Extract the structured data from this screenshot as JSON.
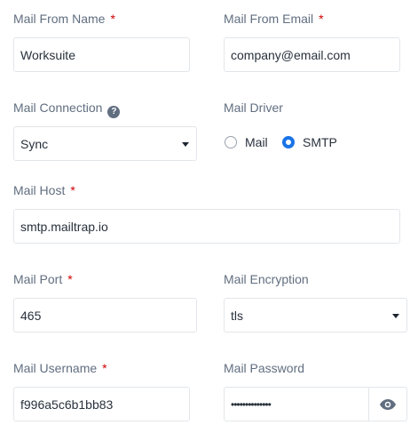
{
  "fields": {
    "mail_from_name": {
      "label": "Mail From Name",
      "required": "*",
      "value": "Worksuite"
    },
    "mail_from_email": {
      "label": "Mail From Email",
      "required": "*",
      "value": "company@email.com"
    },
    "mail_connection": {
      "label": "Mail Connection",
      "help_icon": "question-circle-icon",
      "value": "Sync"
    },
    "mail_driver": {
      "label": "Mail Driver",
      "options": [
        "Mail",
        "SMTP"
      ],
      "selected": "SMTP"
    },
    "mail_host": {
      "label": "Mail Host",
      "required": "*",
      "value": "smtp.mailtrap.io"
    },
    "mail_port": {
      "label": "Mail Port",
      "required": "*",
      "value": "465"
    },
    "mail_encryption": {
      "label": "Mail Encryption",
      "value": "tls"
    },
    "mail_username": {
      "label": "Mail Username",
      "required": "*",
      "value": "f996a5c6b1bb83"
    },
    "mail_password": {
      "label": "Mail Password",
      "masked_value": "••••••••••••••",
      "toggle_icon": "eye-icon"
    }
  },
  "colors": {
    "accent": "#1a73e8",
    "required": "#d30000",
    "label": "#616e80",
    "border": "#e3e6ea"
  }
}
